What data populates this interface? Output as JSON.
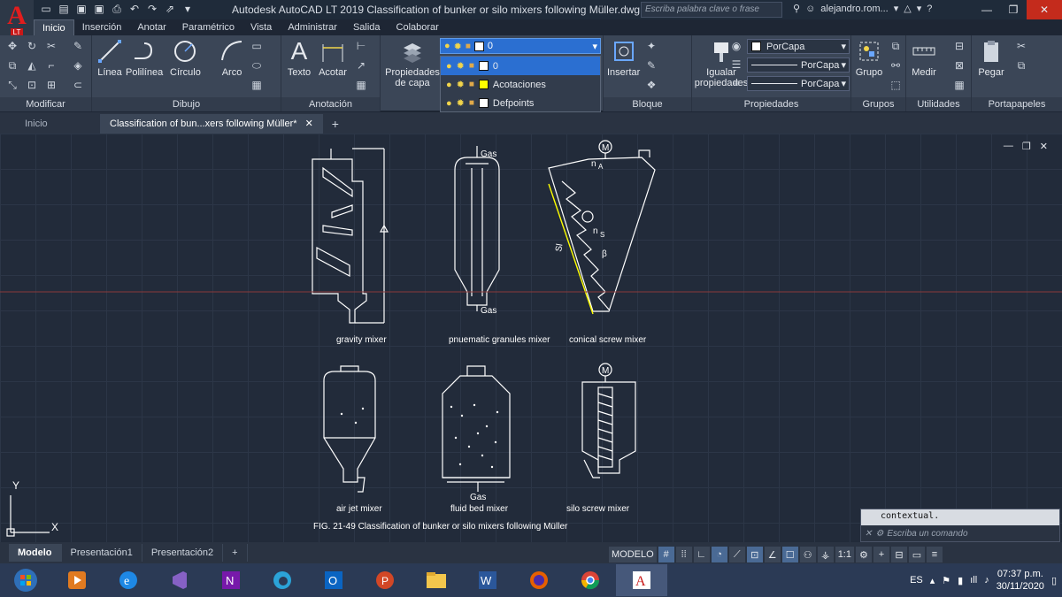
{
  "title_bar": {
    "title": "Autodesk AutoCAD LT 2019    Classification of bunker or silo mixers following Müller.dwg",
    "search_placeholder": "Escriba palabra clave o frase",
    "user": "alejandro.rom...",
    "help": "?"
  },
  "app_logo": {
    "letter": "A",
    "badge": "LT"
  },
  "ribbon_tabs": [
    "Inicio",
    "Inserción",
    "Anotar",
    "Paramétrico",
    "Vista",
    "Administrar",
    "Salida",
    "Colaborar"
  ],
  "ribbon": {
    "modificar": "Modificar",
    "dibujo": "Dibujo",
    "anotacion": "Anotación",
    "bloque": "Bloque",
    "propiedades": "Propiedades",
    "grupos": "Grupos",
    "utilidades": "Utilidades",
    "portapapeles": "Portapapeles",
    "linea": "Línea",
    "polilinea": "Polilínea",
    "circulo": "Círculo",
    "arco": "Arco",
    "texto": "Texto",
    "acotar": "Acotar",
    "prop_capa": "Propiedades de capa",
    "insertar": "Insertar",
    "igualar": "Igualar propiedades",
    "grupo": "Grupo",
    "medir": "Medir",
    "pegar": "Pegar",
    "color_value": "PorCapa",
    "linetype_value": "PorCapa",
    "lineweight_value": "PorCapa"
  },
  "layer_combo": {
    "current": "0"
  },
  "layers": [
    {
      "name": "0",
      "color": "#ffffff",
      "selected": true
    },
    {
      "name": "Acotaciones",
      "color": "#ffff00",
      "selected": false
    },
    {
      "name": "Defpoints",
      "color": "#ffffff",
      "selected": false
    }
  ],
  "doc_tabs": [
    "Inicio",
    "Classification of bun...xers following Müller*"
  ],
  "drawing": {
    "labels": {
      "gravity": "gravity mixer",
      "pneumatic": "pnuematic granules mixer",
      "conical": "conical screw mixer",
      "airjet": "air jet mixer",
      "fluid": "fluid bed mixer",
      "siloscrew": "silo screw mixer",
      "gas_top": "Gas",
      "gas_bottom": "Gas",
      "gas_fluid": "Gas",
      "motor": "M",
      "na": "n",
      "ns": "n",
      "sub_a": "A",
      "sub_s": "S",
      "sl": "Sl",
      "beta": "β"
    },
    "caption": "FIG.   21-49 Classification of bunker or silo mixers following Müller",
    "ucs_y": "Y",
    "ucs_x": "X"
  },
  "command_line": {
    "history": "contextual.",
    "placeholder": "Escriba un comando"
  },
  "layout_tabs": [
    "Modelo",
    "Presentación1",
    "Presentación2"
  ],
  "status": {
    "mode": "MODELO",
    "scale": "1:1"
  },
  "taskbar": {
    "lang": "ES",
    "time": "07:37 p.m.",
    "date": "30/11/2020"
  }
}
